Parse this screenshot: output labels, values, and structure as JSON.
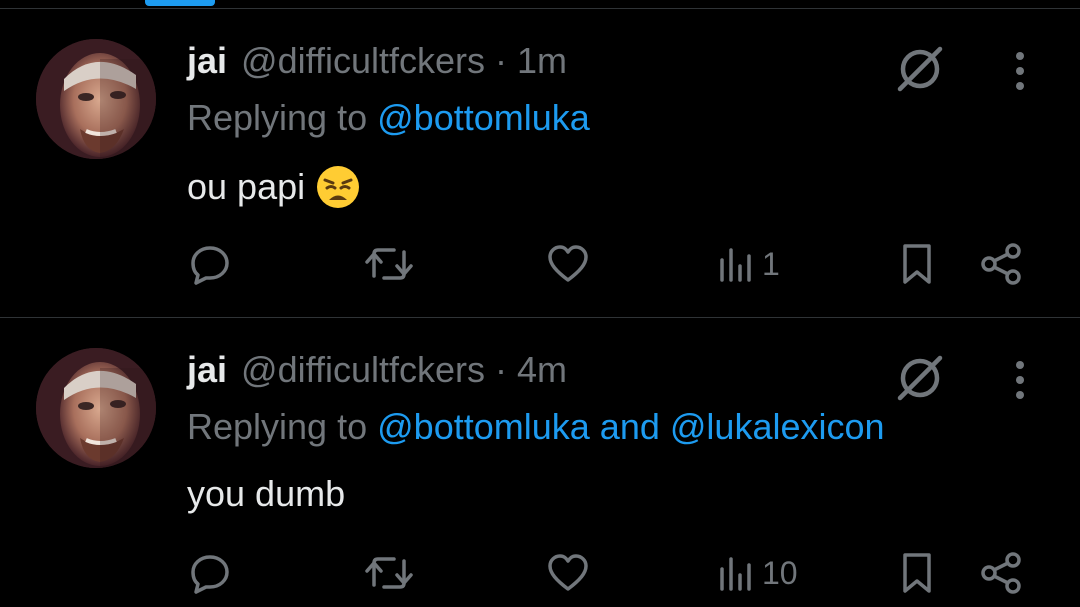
{
  "colors": {
    "background": "#000000",
    "text_primary": "#e7e9ea",
    "text_secondary": "#71767b",
    "accent": "#1d9bf0",
    "divider": "#2f3336"
  },
  "tweets": [
    {
      "name": "jai",
      "handle": "@difficultfckers",
      "separator": "·",
      "time": "1m",
      "replying_prefix": "Replying to",
      "mentions": [
        "@bottomluka"
      ],
      "mention_joiner": "",
      "text": "ou papi",
      "emoji": "weary-face",
      "views": "1",
      "icons": [
        "reply-icon",
        "retweet-icon",
        "like-icon",
        "views-icon",
        "bookmark-icon",
        "share-icon",
        "grok-icon",
        "more-icon"
      ]
    },
    {
      "name": "jai",
      "handle": "@difficultfckers",
      "separator": "·",
      "time": "4m",
      "replying_prefix": "Replying to",
      "mentions": [
        "@bottomluka",
        "@lukalexicon"
      ],
      "mention_joiner": "and",
      "text": "you dumb",
      "emoji": "",
      "views": "10",
      "icons": [
        "reply-icon",
        "retweet-icon",
        "like-icon",
        "views-icon",
        "bookmark-icon",
        "share-icon",
        "grok-icon",
        "more-icon"
      ]
    }
  ]
}
